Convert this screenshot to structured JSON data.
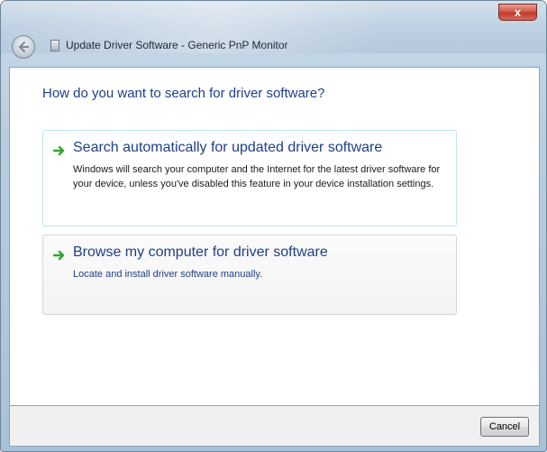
{
  "window": {
    "title": "Update Driver Software - Generic PnP Monitor",
    "close_label": "x"
  },
  "content": {
    "heading": "How do you want to search for driver software?",
    "options": [
      {
        "title": "Search automatically for updated driver software",
        "description": "Windows will search your computer and the Internet for the latest driver software for your device, unless you've disabled this feature in your device installation settings."
      },
      {
        "title": "Browse my computer for driver software",
        "description": "Locate and install driver software manually."
      }
    ]
  },
  "footer": {
    "cancel_label": "Cancel"
  },
  "colors": {
    "heading": "#1b3f8c",
    "arrow": "#2fa82f"
  }
}
